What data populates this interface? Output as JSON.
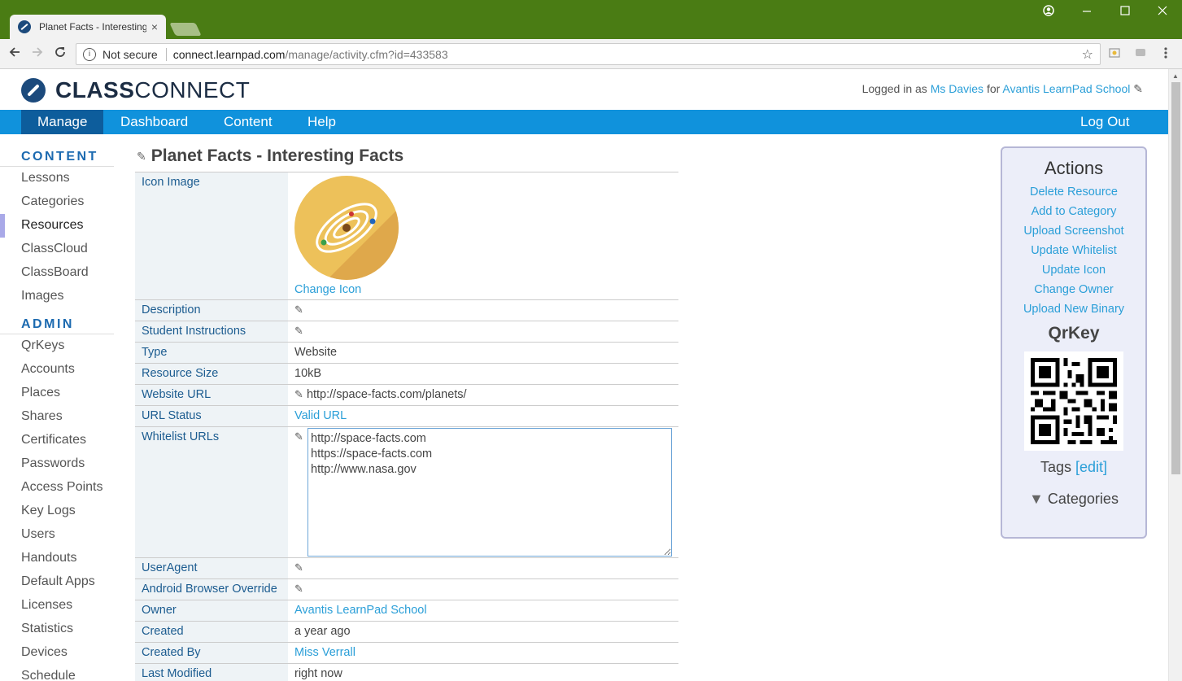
{
  "browser": {
    "tab_title": "Planet Facts - Interesting",
    "tab_close": "×",
    "security_label": "Not secure",
    "url_host": "connect.learnpad.com",
    "url_path": "/manage/activity.cfm?id=433583"
  },
  "header": {
    "logo_bold": "CLASS",
    "logo_regular": "CONNECT",
    "logged_prefix": "Logged in as",
    "user": "Ms Davies",
    "for_text": "for",
    "school": "Avantis LearnPad School"
  },
  "nav": {
    "items": [
      "Manage",
      "Dashboard",
      "Content",
      "Help"
    ],
    "logout": "Log Out"
  },
  "sidebar": {
    "content_heading": "CONTENT",
    "content_items": [
      "Lessons",
      "Categories",
      "Resources",
      "ClassCloud",
      "ClassBoard",
      "Images"
    ],
    "admin_heading": "ADMIN",
    "admin_items": [
      "QrKeys",
      "Accounts",
      "Places",
      "Shares",
      "Certificates",
      "Passwords",
      "Access Points",
      "Key Logs",
      "Users",
      "Handouts",
      "Default Apps",
      "Licenses",
      "Statistics",
      "Devices",
      "Schedule"
    ]
  },
  "resource": {
    "title": "Planet Facts - Interesting Facts",
    "rows": {
      "icon_label": "Icon Image",
      "change_icon": "Change Icon",
      "description_label": "Description",
      "instructions_label": "Student Instructions",
      "type_label": "Type",
      "type_value": "Website",
      "size_label": "Resource Size",
      "size_value": "10kB",
      "url_label": "Website URL",
      "url_value": "http://space-facts.com/planets/",
      "status_label": "URL Status",
      "status_value": "Valid URL",
      "whitelist_label": "Whitelist URLs",
      "whitelist_value": "http://space-facts.com\nhttps://space-facts.com\nhttp://www.nasa.gov",
      "useragent_label": "UserAgent",
      "android_label": "Android Browser Override",
      "owner_label": "Owner",
      "owner_value": "Avantis LearnPad School",
      "created_label": "Created",
      "created_value": "a year ago",
      "createdby_label": "Created By",
      "createdby_value": "Miss Verrall",
      "modified_label": "Last Modified",
      "modified_value": "right now"
    }
  },
  "actions": {
    "heading": "Actions",
    "links": [
      "Delete Resource",
      "Add to Category",
      "Upload Screenshot",
      "Update Whitelist",
      "Update Icon",
      "Change Owner",
      "Upload New Binary"
    ],
    "qrkey_heading": "QrKey",
    "tags_label": "Tags",
    "tags_edit": "[edit]",
    "categories_label": "Categories"
  }
}
